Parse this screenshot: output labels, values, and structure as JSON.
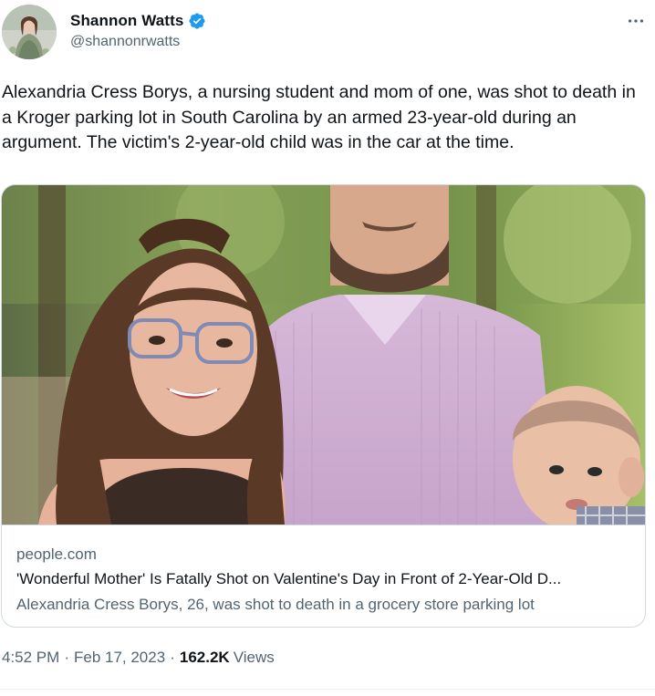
{
  "author": {
    "display_name": "Shannon Watts",
    "handle": "@shannonrwatts",
    "verified": true,
    "verified_color": "#1d9bf0"
  },
  "tweet": {
    "text": "Alexandria Cress Borys, a nursing student and mom of one, was shot to death in a Kroger parking lot in South Carolina by an armed 23-year-old during an argument. The victim's 2-year-old child was in the car at the time."
  },
  "card": {
    "domain": "people.com",
    "title": "'Wonderful Mother' Is Fatally Shot on Valentine's Day in Front of 2-Year-Old D...",
    "description": "Alexandria Cress Borys, 26, was shot to death in a grocery store parking lot"
  },
  "meta": {
    "time": "4:52 PM",
    "separator": "·",
    "date": "Feb 17, 2023",
    "views_count": "162.2K",
    "views_label": "Views"
  },
  "icons": {
    "more": "more-options-icon",
    "verified": "verified-badge-icon"
  },
  "colors": {
    "text_primary": "#0f1419",
    "text_secondary": "#536471",
    "border": "#cfd9de"
  }
}
